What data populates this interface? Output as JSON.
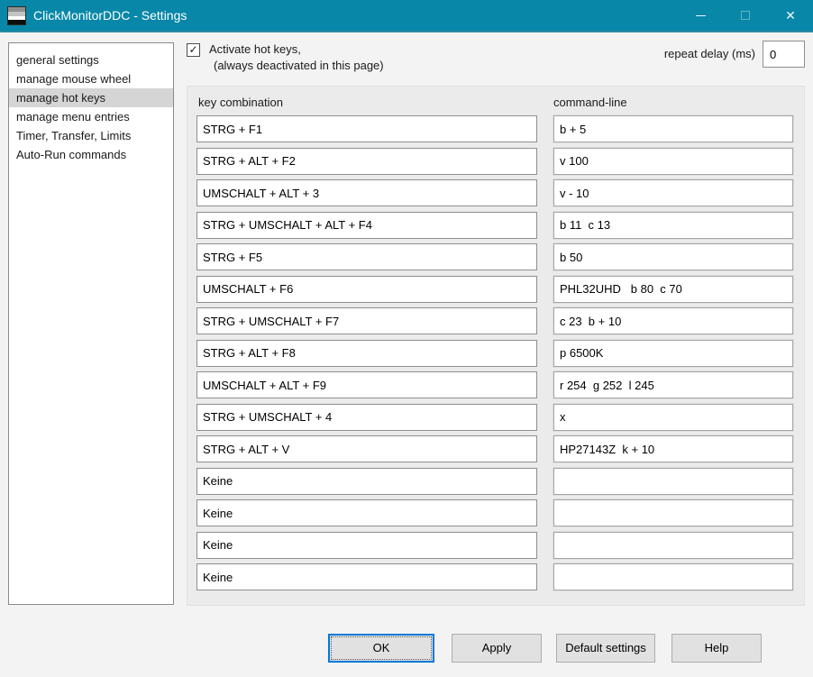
{
  "window": {
    "title": "ClickMonitorDDC - Settings"
  },
  "icons": {
    "check": "✓",
    "close": "✕"
  },
  "colors": {
    "titlebar": "#0887a8",
    "panel": "#ebebeb",
    "selected_item": "#d5d5d5",
    "focus_border": "#0078d7"
  },
  "sidebar": {
    "items": [
      {
        "label": "general settings",
        "selected": false
      },
      {
        "label": "manage mouse wheel",
        "selected": false
      },
      {
        "label": "manage hot keys",
        "selected": true
      },
      {
        "label": "manage menu entries",
        "selected": false
      },
      {
        "label": "Timer, Transfer, Limits",
        "selected": false
      },
      {
        "label": "Auto-Run commands",
        "selected": false
      }
    ]
  },
  "header": {
    "activate_checkbox": {
      "checked": true,
      "label_line1": "Activate hot keys,",
      "label_line2": "(always deactivated in this page)"
    },
    "repeat_delay": {
      "label": "repeat delay (ms)",
      "value": "0"
    }
  },
  "hotkeys": {
    "column_key": "key combination",
    "column_cmd": "command-line",
    "rows": [
      {
        "key": "STRG + F1",
        "cmd": "b + 5"
      },
      {
        "key": "STRG + ALT + F2",
        "cmd": "v 100"
      },
      {
        "key": "UMSCHALT + ALT + 3",
        "cmd": "v - 10"
      },
      {
        "key": "STRG + UMSCHALT + ALT + F4",
        "cmd": "b 11  c 13"
      },
      {
        "key": "STRG + F5",
        "cmd": "b 50"
      },
      {
        "key": "UMSCHALT + F6",
        "cmd": "PHL32UHD   b 80  c 70"
      },
      {
        "key": "STRG + UMSCHALT + F7",
        "cmd": "c 23  b + 10"
      },
      {
        "key": "STRG + ALT + F8",
        "cmd": "p 6500K"
      },
      {
        "key": "UMSCHALT + ALT + F9",
        "cmd": "r 254  g 252  l 245"
      },
      {
        "key": "STRG + UMSCHALT + 4",
        "cmd": "x"
      },
      {
        "key": "STRG + ALT + V",
        "cmd": "HP27143Z  k + 10"
      },
      {
        "key": "Keine",
        "cmd": ""
      },
      {
        "key": "Keine",
        "cmd": ""
      },
      {
        "key": "Keine",
        "cmd": ""
      },
      {
        "key": "Keine",
        "cmd": ""
      }
    ]
  },
  "footer": {
    "ok": "OK",
    "apply": "Apply",
    "default_settings": "Default settings",
    "help": "Help"
  }
}
